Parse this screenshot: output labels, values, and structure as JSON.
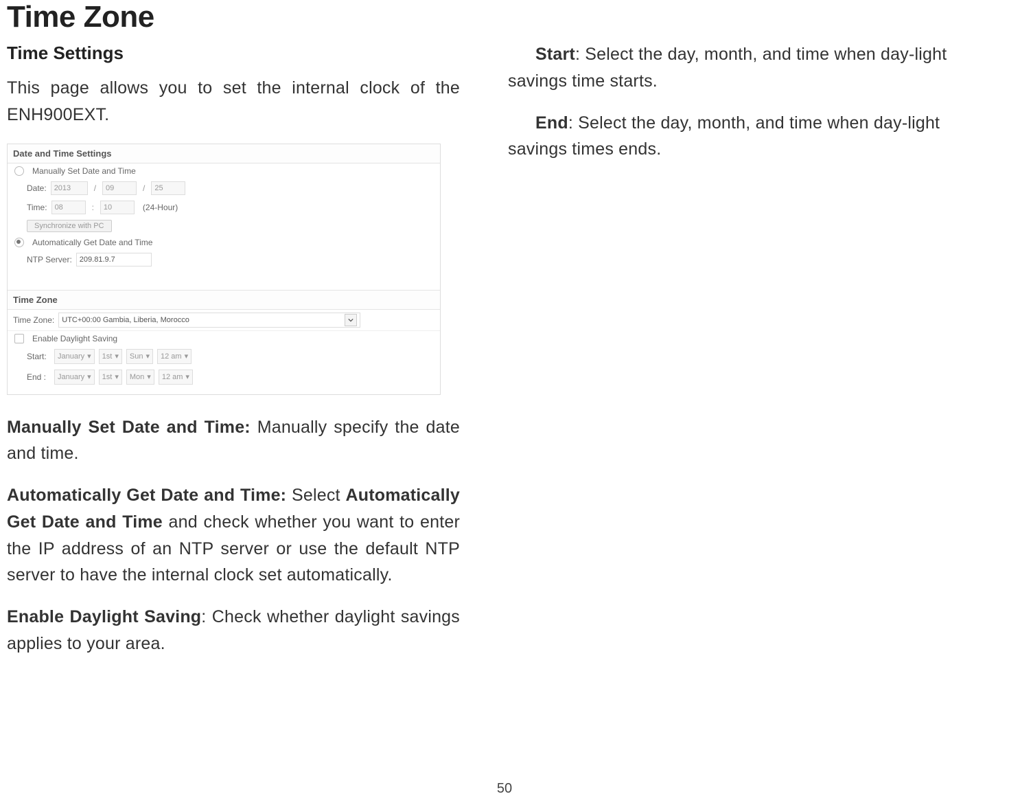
{
  "page_number": "50",
  "left": {
    "title": "Time Zone",
    "subtitle": "Time Settings",
    "intro": "This page allows you to set the internal clock of the ENH900EXT.",
    "para1_b": "Manually Set Date and Time:",
    "para1_t": " Manually specify the date and time.",
    "para2_b1": "Automatically Get Date and Time:",
    "para2_t1": " Select ",
    "para2_b2": "Automatically Get Date and Time",
    "para2_t2": " and check whether you want to enter the IP address of an NTP server or use the default NTP server to have the internal clock set automatically.",
    "para3_b": "Enable Daylight Saving",
    "para3_t": ": Check whether daylight savings applies to your area."
  },
  "right": {
    "start_b": "Start",
    "start_t": ": Select the day, month, and time when day-light savings time starts.",
    "end_b": "End",
    "end_t": ": Select the day, month, and time when day-light savings times ends."
  },
  "ui": {
    "header1": "Date and Time Settings",
    "manual_label": "Manually Set Date and Time",
    "date_label": "Date:",
    "date_year": "2013",
    "date_month": "09",
    "date_day": "25",
    "time_label": "Time:",
    "time_h": "08",
    "time_m": "10",
    "time_fmt": "(24-Hour)",
    "sync_btn": "Synchronize with PC",
    "auto_label": "Automatically Get Date and Time",
    "ntp_label": "NTP Server:",
    "ntp_value": "209.81.9.7",
    "header2": "Time Zone",
    "tz_label": "Time Zone:",
    "tz_value": "UTC+00:00 Gambia, Liberia, Morocco",
    "dls_label": "Enable Daylight Saving",
    "start_label": "Start:",
    "end_label": "End :",
    "month_jan": "January",
    "ord_1st": "1st",
    "day_sun": "Sun",
    "day_mon": "Mon",
    "time_12am": "12 am"
  }
}
